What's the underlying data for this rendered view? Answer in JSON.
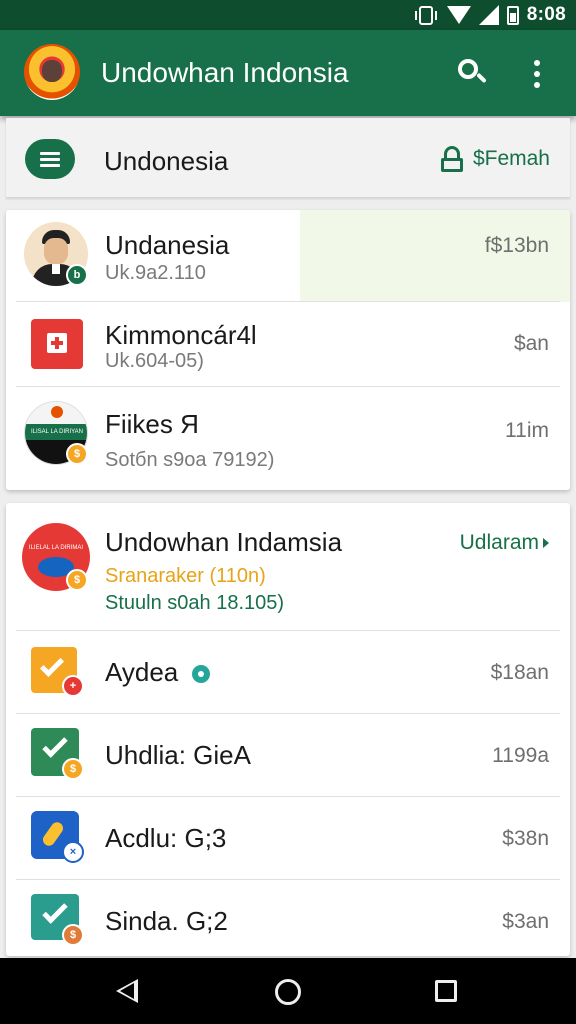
{
  "status_bar": {
    "time": "8:08"
  },
  "app_bar": {
    "title": "Undowhan Indonsia"
  },
  "filter_bar": {
    "title": "Undonesia",
    "action_label": "$Femah"
  },
  "card1": {
    "rows": [
      {
        "title": "Undanesia",
        "subtitle": "Uk.9a2.110",
        "meta": "f$13bn",
        "badge": "b"
      },
      {
        "title": "Kimmoncár4l",
        "subtitle": "Uk.604-05)",
        "meta": "$an"
      },
      {
        "title": "Fiikes Я",
        "subtitle": "Sotбn s9oa 79192)",
        "meta": "11im",
        "flag_text": "ILISAL LA DIRIYAN"
      }
    ]
  },
  "card2": {
    "header": {
      "title": "Undowhan Indamsia",
      "meta": "Udlaram",
      "line1": "Sranaraker (110n)",
      "line2": "Stuuln s0ah 18.105)",
      "avatar_text": "ILIELAL LA DIRIMAI"
    },
    "rows": [
      {
        "title": "Aydea",
        "meta": "$18an"
      },
      {
        "title": "Uhdlia: GieA",
        "meta": "1199a"
      },
      {
        "title": "Acdlu: G;3",
        "meta": "$38n"
      },
      {
        "title": "Sinda. G;2",
        "meta": "$3an"
      }
    ]
  },
  "colors": {
    "primary": "#17704a",
    "status_bar": "#0e4d2e",
    "accent_orange": "#f5a623",
    "red": "#e53935"
  }
}
